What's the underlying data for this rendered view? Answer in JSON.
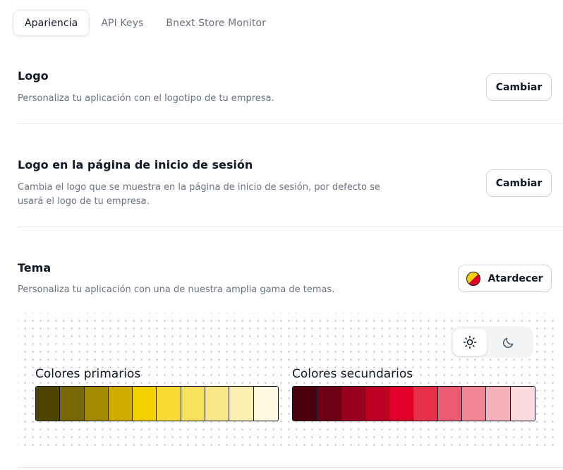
{
  "tabs": [
    {
      "label": "Apariencia",
      "active": true
    },
    {
      "label": "API Keys",
      "active": false
    },
    {
      "label": "Bnext Store Monitor",
      "active": false
    }
  ],
  "logo_section": {
    "title": "Logo",
    "description": "Personaliza tu aplicación con el logotipo de tu empresa.",
    "button_label": "Cambiar"
  },
  "login_logo_section": {
    "title": "Logo en la página de inicio de sesión",
    "description": "Cambia el logo que se muestra en la página de inicio de sesión, por defecto se usará el logo de tu empresa.",
    "button_label": "Cambiar"
  },
  "theme_section": {
    "title": "Tema",
    "description": "Personaliza tu aplicación con una de nuestra amplia gama de temas.",
    "theme_button_label": "Atardecer",
    "theme_icon": "theme-swatch-icon",
    "mode": {
      "options": [
        "sun-icon",
        "moon-icon"
      ],
      "selected": "sun-icon"
    }
  },
  "palettes": {
    "primary": {
      "label": "Colores primarios",
      "colors": [
        "#4f4503",
        "#776804",
        "#a38b01",
        "#cfad00",
        "#f5d000",
        "#f8dc33",
        "#f9e25b",
        "#fae888",
        "#fbf0b2",
        "#fdf9de"
      ]
    },
    "secondary": {
      "label": "Colores secundarios",
      "colors": [
        "#4c000d",
        "#6e0015",
        "#96001e",
        "#be0024",
        "#e0002a",
        "#e73148",
        "#ec5b72",
        "#f18795",
        "#f6b1ba",
        "#fadce0"
      ]
    }
  }
}
